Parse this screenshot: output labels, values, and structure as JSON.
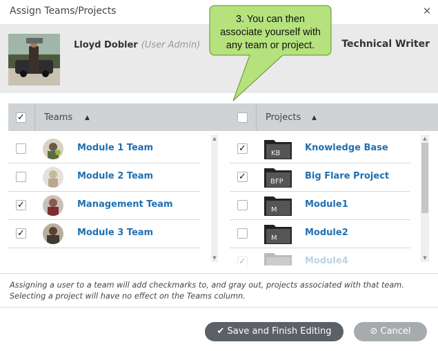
{
  "dialog": {
    "title": "Assign Teams/Projects",
    "close_icon": "close-icon"
  },
  "user": {
    "name": "Lloyd Dobler",
    "role": "(User Admin)",
    "job_title": "Technical Writer"
  },
  "callout": {
    "lines": [
      "3. You can then",
      "associate yourself with",
      "any team or project."
    ],
    "color": "#b5e27c"
  },
  "teams_column": {
    "header_label": "Teams",
    "sort_icon": "sort-ascending-icon",
    "header_checked": "✓",
    "rows": [
      {
        "name": "Module 1 Team",
        "checked": ""
      },
      {
        "name": "Module 2 Team",
        "checked": ""
      },
      {
        "name": "Management Team",
        "checked": "✓"
      },
      {
        "name": "Module 3 Team",
        "checked": "✓"
      }
    ]
  },
  "projects_column": {
    "header_label": "Projects",
    "sort_icon": "sort-ascending-icon",
    "header_checked": "",
    "rows": [
      {
        "name": "Knowledge Base",
        "abbr": "KB",
        "checked": "✓"
      },
      {
        "name": "Big Flare Project",
        "abbr": "BFP",
        "checked": "✓"
      },
      {
        "name": "Module1",
        "abbr": "M",
        "checked": ""
      },
      {
        "name": "Module2",
        "abbr": "M",
        "checked": ""
      },
      {
        "name": "Module4",
        "abbr": "",
        "checked": "✓"
      }
    ]
  },
  "note": {
    "line1": "Assigning a user to a team will add checkmarks to, and gray out, projects associated with that team.",
    "line2": "Selecting a project will have no effect on the Teams column."
  },
  "buttons": {
    "save_label": "Save and Finish Editing",
    "cancel_label": "Cancel"
  },
  "colors": {
    "link": "#1f6fb2",
    "header_band": "#cfd3d5",
    "user_band": "#eaeaea",
    "save_button": "#5b6166",
    "cancel_button": "#a6abae"
  }
}
